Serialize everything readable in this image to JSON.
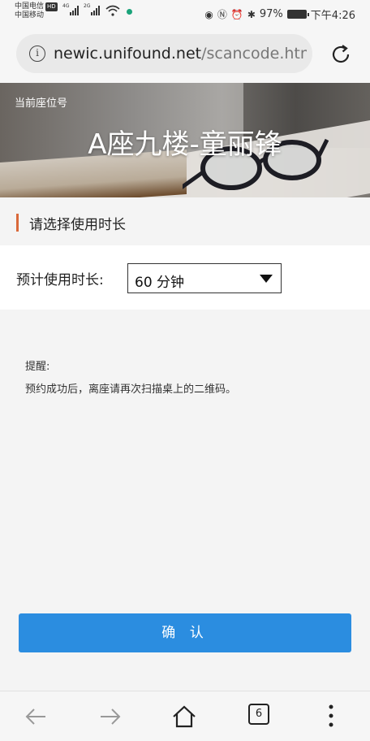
{
  "status_bar": {
    "carrier_1": "中国电信",
    "carrier_2": "中国移动",
    "hd_badge": "HD",
    "network_1": "4G",
    "network_2": "2G",
    "battery": "97%",
    "time": "下午4:26"
  },
  "browser": {
    "url_host": "newic.unifound.net",
    "url_path": "/scancode.htm"
  },
  "banner": {
    "seat_label": "当前座位号",
    "seat_title": "A座九楼-童丽锋"
  },
  "form": {
    "section_title": "请选择使用时长",
    "duration_label": "预计使用时长:",
    "duration_value": "60 分钟"
  },
  "reminder": {
    "title": "提醒:",
    "text": "预约成功后，离座请再次扫描桌上的二维码。"
  },
  "confirm_label": "确 认",
  "bottom_nav": {
    "tabs_count": "6"
  },
  "colors": {
    "accent_bar": "#d9693a",
    "confirm_button": "#2b8de0"
  }
}
